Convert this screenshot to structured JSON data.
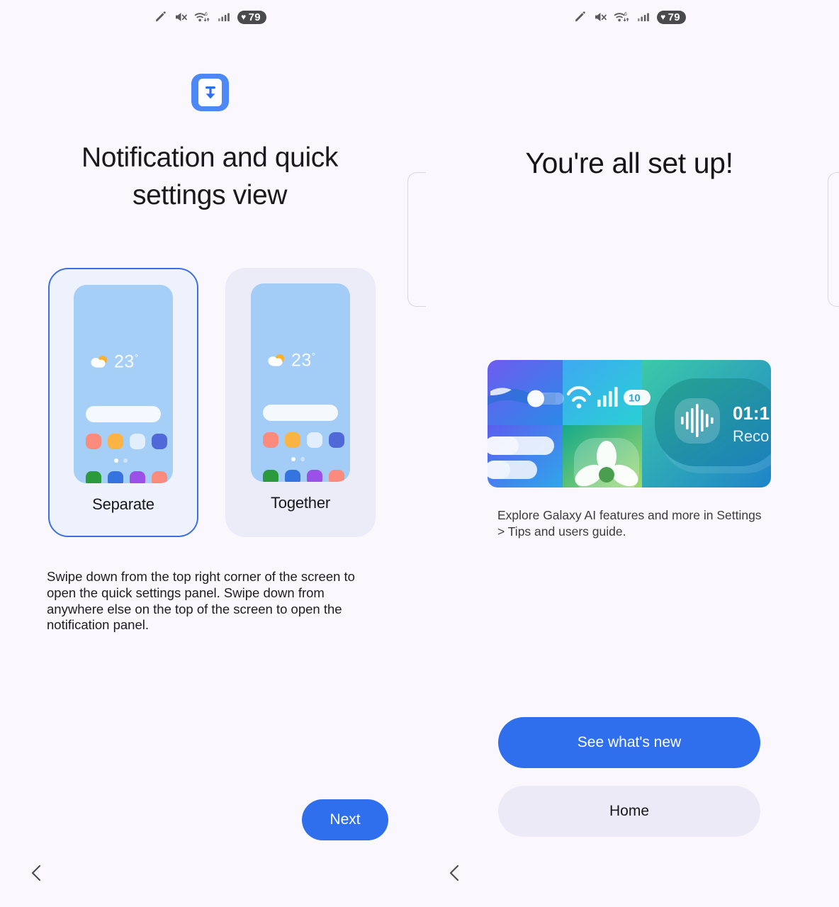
{
  "status_bar": {
    "icons": [
      "stylus-icon",
      "mute-icon",
      "wifi-icon",
      "signal-icon"
    ],
    "wifi_label": "6",
    "battery": {
      "heart": "♥",
      "level": "79"
    }
  },
  "left_panel": {
    "app_icon_name": "notification-panel-icon",
    "title": "Notification and quick settings view",
    "options": [
      {
        "label": "Separate",
        "selected": true,
        "preview": {
          "temperature": "23",
          "degree": "°",
          "row1_colors": [
            "#fa8b7d",
            "#f9b445",
            "#e2eefc",
            "#5169d8"
          ],
          "row2_colors": [
            "#2a9a3c",
            "#3573df",
            "#9b51e8",
            "#fa8b7d"
          ],
          "pages": 2,
          "active_page": 1
        }
      },
      {
        "label": "Together",
        "selected": false,
        "preview": {
          "temperature": "23",
          "degree": "°",
          "row1_colors": [
            "#fa8b7d",
            "#f9b445",
            "#e2eefc",
            "#5169d8"
          ],
          "row2_colors": [
            "#2a9a3c",
            "#3573df",
            "#9b51e8",
            "#fa8b7d"
          ],
          "pages": 2,
          "active_page": 1
        }
      }
    ],
    "description": "Swipe down from the top right corner of the screen to open the quick settings panel. Swipe down from anywhere else on the top of the screen to open the notification panel.",
    "next_label": "Next"
  },
  "right_panel": {
    "title": "You're all set up!",
    "illustration": {
      "name": "galaxy-ai-features-illustration",
      "badge_value": "10",
      "recording_time": "01:1",
      "recording_label": "Reco"
    },
    "caption": "Explore Galaxy AI features and more in Settings > Tips and users guide.",
    "primary_button": "See what's new",
    "secondary_button": "Home"
  },
  "navigation": {
    "back_label": "‹"
  },
  "colors": {
    "accent": "#2f6fee",
    "selected_border": "#3d6fe0",
    "background": "#faf8fc",
    "card_background": "#ecebf8",
    "secondary_button": "#eceaf6"
  }
}
